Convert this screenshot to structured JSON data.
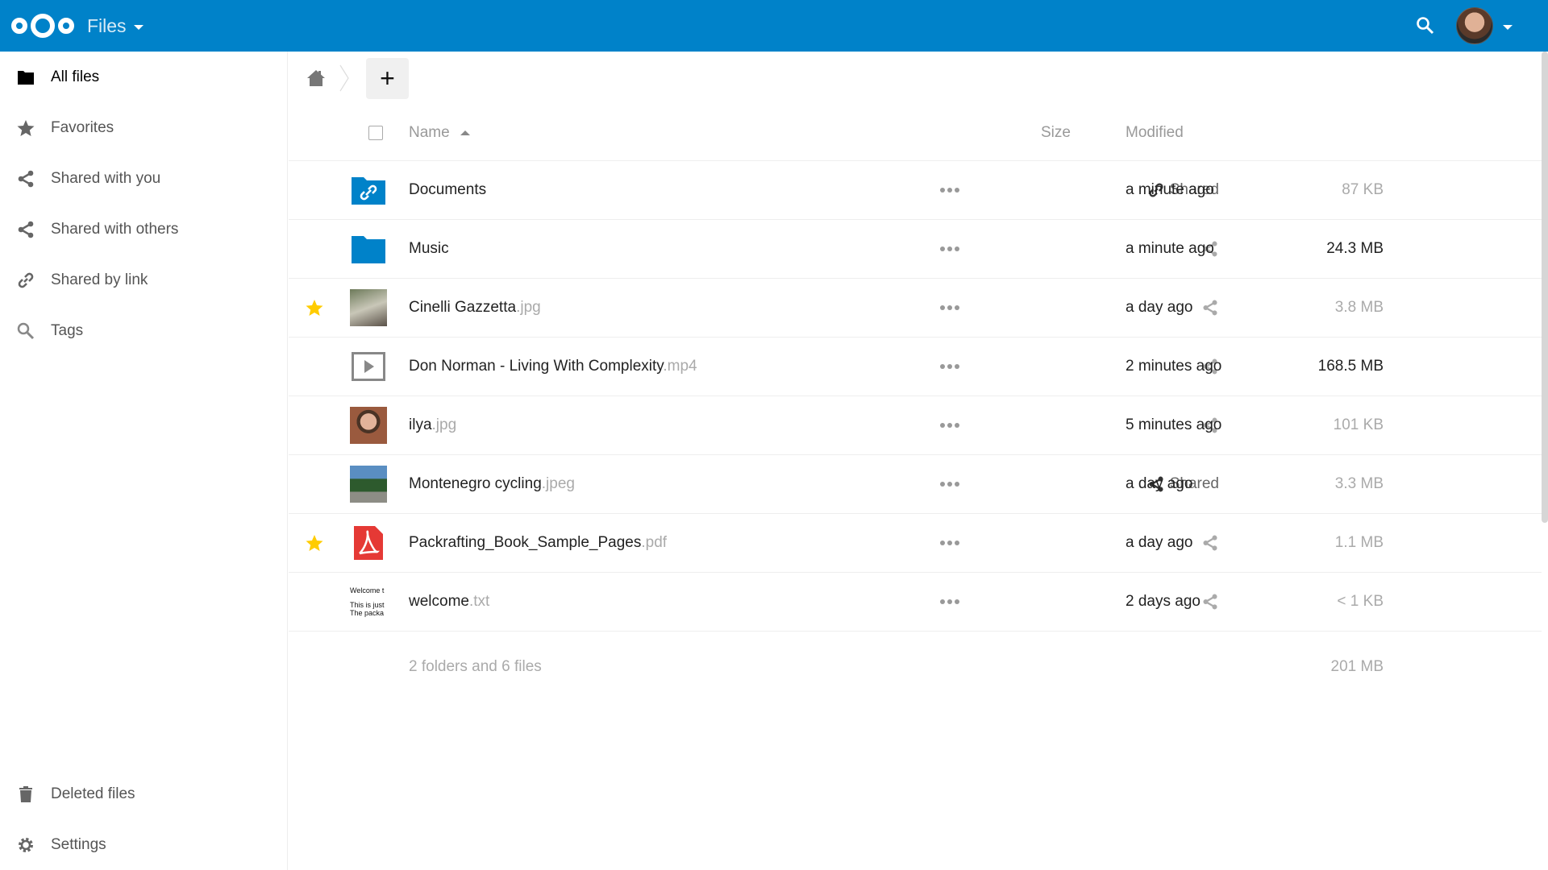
{
  "header": {
    "app_name": "Files",
    "search_icon": "search-icon",
    "colors": {
      "brand": "#0082c9"
    }
  },
  "sidebar": {
    "items": [
      {
        "label": "All files",
        "icon": "folder-icon",
        "active": true
      },
      {
        "label": "Favorites",
        "icon": "star-icon"
      },
      {
        "label": "Shared with you",
        "icon": "share-icon"
      },
      {
        "label": "Shared with others",
        "icon": "share-icon"
      },
      {
        "label": "Shared by link",
        "icon": "link-icon"
      },
      {
        "label": "Tags",
        "icon": "tag-search-icon"
      }
    ],
    "bottom": [
      {
        "label": "Deleted files",
        "icon": "trash-icon"
      },
      {
        "label": "Settings",
        "icon": "gear-icon"
      }
    ]
  },
  "toolbar": {
    "new_label": "+"
  },
  "table": {
    "columns": {
      "name": "Name",
      "size": "Size",
      "modified": "Modified"
    },
    "rows": [
      {
        "name": "Documents",
        "ext": "",
        "type": "shared-folder",
        "favorite": false,
        "share": "Shared",
        "share_icon": "link-icon",
        "size": "87 KB",
        "size_dark": false,
        "modified": "a minute ago"
      },
      {
        "name": "Music",
        "ext": "",
        "type": "folder",
        "favorite": false,
        "share": "",
        "share_icon": "share-icon",
        "size": "24.3 MB",
        "size_dark": true,
        "modified": "a minute ago"
      },
      {
        "name": "Cinelli Gazzetta",
        "ext": ".jpg",
        "type": "photo",
        "favorite": true,
        "share": "",
        "share_icon": "share-icon",
        "size": "3.8 MB",
        "size_dark": false,
        "modified": "a day ago"
      },
      {
        "name": "Don Norman - Living With Complexity",
        "ext": ".mp4",
        "type": "video",
        "favorite": false,
        "share": "",
        "share_icon": "share-icon",
        "size": "168.5 MB",
        "size_dark": true,
        "modified": "2 minutes ago"
      },
      {
        "name": "ilya",
        "ext": ".jpg",
        "type": "portrait",
        "favorite": false,
        "share": "",
        "share_icon": "share-icon",
        "size": "101 KB",
        "size_dark": false,
        "modified": "5 minutes ago"
      },
      {
        "name": "Montenegro cycling",
        "ext": ".jpeg",
        "type": "landscape",
        "favorite": false,
        "share": "Shared",
        "share_icon": "share-icon",
        "size": "3.3 MB",
        "size_dark": false,
        "modified": "a day ago"
      },
      {
        "name": "Packrafting_Book_Sample_Pages",
        "ext": ".pdf",
        "type": "pdf",
        "favorite": true,
        "share": "",
        "share_icon": "share-icon",
        "size": "1.1 MB",
        "size_dark": false,
        "modified": "a day ago"
      },
      {
        "name": "welcome",
        "ext": ".txt",
        "type": "text",
        "favorite": false,
        "share": "",
        "share_icon": "share-icon",
        "size": "< 1 KB",
        "size_dark": false,
        "modified": "2 days ago",
        "preview": [
          "Welcome t",
          "This is just",
          "The packa"
        ]
      }
    ],
    "summary": {
      "counts": "2 folders and 6 files",
      "total": "201 MB"
    }
  }
}
